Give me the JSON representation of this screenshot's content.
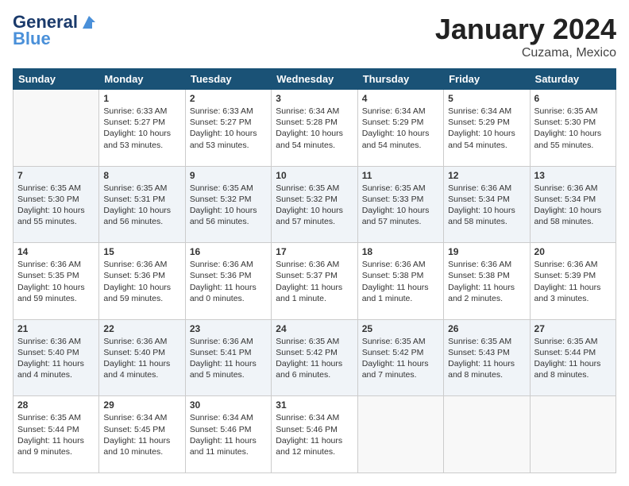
{
  "logo": {
    "line1": "General",
    "line2": "Blue"
  },
  "title": "January 2024",
  "location": "Cuzama, Mexico",
  "weekdays": [
    "Sunday",
    "Monday",
    "Tuesday",
    "Wednesday",
    "Thursday",
    "Friday",
    "Saturday"
  ],
  "weeks": [
    [
      {
        "day": "",
        "sunrise": "",
        "sunset": "",
        "daylight": ""
      },
      {
        "day": "1",
        "sunrise": "Sunrise: 6:33 AM",
        "sunset": "Sunset: 5:27 PM",
        "daylight": "Daylight: 10 hours and 53 minutes."
      },
      {
        "day": "2",
        "sunrise": "Sunrise: 6:33 AM",
        "sunset": "Sunset: 5:27 PM",
        "daylight": "Daylight: 10 hours and 53 minutes."
      },
      {
        "day": "3",
        "sunrise": "Sunrise: 6:34 AM",
        "sunset": "Sunset: 5:28 PM",
        "daylight": "Daylight: 10 hours and 54 minutes."
      },
      {
        "day": "4",
        "sunrise": "Sunrise: 6:34 AM",
        "sunset": "Sunset: 5:29 PM",
        "daylight": "Daylight: 10 hours and 54 minutes."
      },
      {
        "day": "5",
        "sunrise": "Sunrise: 6:34 AM",
        "sunset": "Sunset: 5:29 PM",
        "daylight": "Daylight: 10 hours and 54 minutes."
      },
      {
        "day": "6",
        "sunrise": "Sunrise: 6:35 AM",
        "sunset": "Sunset: 5:30 PM",
        "daylight": "Daylight: 10 hours and 55 minutes."
      }
    ],
    [
      {
        "day": "7",
        "sunrise": "Sunrise: 6:35 AM",
        "sunset": "Sunset: 5:30 PM",
        "daylight": "Daylight: 10 hours and 55 minutes."
      },
      {
        "day": "8",
        "sunrise": "Sunrise: 6:35 AM",
        "sunset": "Sunset: 5:31 PM",
        "daylight": "Daylight: 10 hours and 56 minutes."
      },
      {
        "day": "9",
        "sunrise": "Sunrise: 6:35 AM",
        "sunset": "Sunset: 5:32 PM",
        "daylight": "Daylight: 10 hours and 56 minutes."
      },
      {
        "day": "10",
        "sunrise": "Sunrise: 6:35 AM",
        "sunset": "Sunset: 5:32 PM",
        "daylight": "Daylight: 10 hours and 57 minutes."
      },
      {
        "day": "11",
        "sunrise": "Sunrise: 6:35 AM",
        "sunset": "Sunset: 5:33 PM",
        "daylight": "Daylight: 10 hours and 57 minutes."
      },
      {
        "day": "12",
        "sunrise": "Sunrise: 6:36 AM",
        "sunset": "Sunset: 5:34 PM",
        "daylight": "Daylight: 10 hours and 58 minutes."
      },
      {
        "day": "13",
        "sunrise": "Sunrise: 6:36 AM",
        "sunset": "Sunset: 5:34 PM",
        "daylight": "Daylight: 10 hours and 58 minutes."
      }
    ],
    [
      {
        "day": "14",
        "sunrise": "Sunrise: 6:36 AM",
        "sunset": "Sunset: 5:35 PM",
        "daylight": "Daylight: 10 hours and 59 minutes."
      },
      {
        "day": "15",
        "sunrise": "Sunrise: 6:36 AM",
        "sunset": "Sunset: 5:36 PM",
        "daylight": "Daylight: 10 hours and 59 minutes."
      },
      {
        "day": "16",
        "sunrise": "Sunrise: 6:36 AM",
        "sunset": "Sunset: 5:36 PM",
        "daylight": "Daylight: 11 hours and 0 minutes."
      },
      {
        "day": "17",
        "sunrise": "Sunrise: 6:36 AM",
        "sunset": "Sunset: 5:37 PM",
        "daylight": "Daylight: 11 hours and 1 minute."
      },
      {
        "day": "18",
        "sunrise": "Sunrise: 6:36 AM",
        "sunset": "Sunset: 5:38 PM",
        "daylight": "Daylight: 11 hours and 1 minute."
      },
      {
        "day": "19",
        "sunrise": "Sunrise: 6:36 AM",
        "sunset": "Sunset: 5:38 PM",
        "daylight": "Daylight: 11 hours and 2 minutes."
      },
      {
        "day": "20",
        "sunrise": "Sunrise: 6:36 AM",
        "sunset": "Sunset: 5:39 PM",
        "daylight": "Daylight: 11 hours and 3 minutes."
      }
    ],
    [
      {
        "day": "21",
        "sunrise": "Sunrise: 6:36 AM",
        "sunset": "Sunset: 5:40 PM",
        "daylight": "Daylight: 11 hours and 4 minutes."
      },
      {
        "day": "22",
        "sunrise": "Sunrise: 6:36 AM",
        "sunset": "Sunset: 5:40 PM",
        "daylight": "Daylight: 11 hours and 4 minutes."
      },
      {
        "day": "23",
        "sunrise": "Sunrise: 6:36 AM",
        "sunset": "Sunset: 5:41 PM",
        "daylight": "Daylight: 11 hours and 5 minutes."
      },
      {
        "day": "24",
        "sunrise": "Sunrise: 6:35 AM",
        "sunset": "Sunset: 5:42 PM",
        "daylight": "Daylight: 11 hours and 6 minutes."
      },
      {
        "day": "25",
        "sunrise": "Sunrise: 6:35 AM",
        "sunset": "Sunset: 5:42 PM",
        "daylight": "Daylight: 11 hours and 7 minutes."
      },
      {
        "day": "26",
        "sunrise": "Sunrise: 6:35 AM",
        "sunset": "Sunset: 5:43 PM",
        "daylight": "Daylight: 11 hours and 8 minutes."
      },
      {
        "day": "27",
        "sunrise": "Sunrise: 6:35 AM",
        "sunset": "Sunset: 5:44 PM",
        "daylight": "Daylight: 11 hours and 8 minutes."
      }
    ],
    [
      {
        "day": "28",
        "sunrise": "Sunrise: 6:35 AM",
        "sunset": "Sunset: 5:44 PM",
        "daylight": "Daylight: 11 hours and 9 minutes."
      },
      {
        "day": "29",
        "sunrise": "Sunrise: 6:34 AM",
        "sunset": "Sunset: 5:45 PM",
        "daylight": "Daylight: 11 hours and 10 minutes."
      },
      {
        "day": "30",
        "sunrise": "Sunrise: 6:34 AM",
        "sunset": "Sunset: 5:46 PM",
        "daylight": "Daylight: 11 hours and 11 minutes."
      },
      {
        "day": "31",
        "sunrise": "Sunrise: 6:34 AM",
        "sunset": "Sunset: 5:46 PM",
        "daylight": "Daylight: 11 hours and 12 minutes."
      },
      {
        "day": "",
        "sunrise": "",
        "sunset": "",
        "daylight": ""
      },
      {
        "day": "",
        "sunrise": "",
        "sunset": "",
        "daylight": ""
      },
      {
        "day": "",
        "sunrise": "",
        "sunset": "",
        "daylight": ""
      }
    ]
  ]
}
